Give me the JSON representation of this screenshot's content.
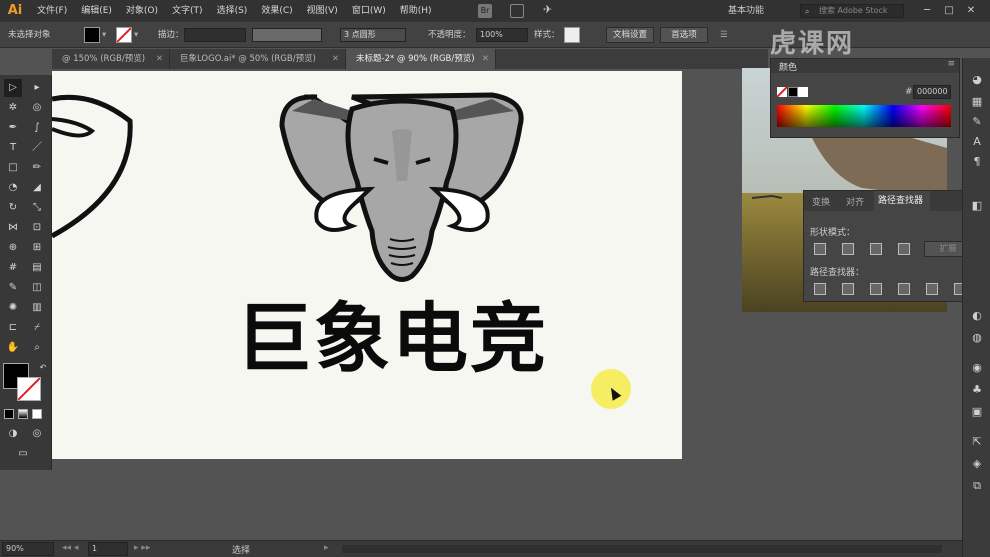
{
  "app": {
    "logo": "Ai"
  },
  "menu": [
    "文件(F)",
    "编辑(E)",
    "对象(O)",
    "文字(T)",
    "选择(S)",
    "效果(C)",
    "视图(V)",
    "窗口(W)",
    "帮助(H)"
  ],
  "workspace": "基本功能",
  "search_placeholder": "搜索 Adobe Stock",
  "control": {
    "selection": "未选择对象",
    "stroke_label": "描边：",
    "brush": "3 点圆形",
    "opacity_label": "不透明度：",
    "opacity_value": "100%",
    "style_label": "样式：",
    "doc_setup": "文档设置",
    "preferences": "首选项"
  },
  "tabs": [
    {
      "label": "@ 150% (RGB/预览)",
      "active": false
    },
    {
      "label": "巨象LOGO.ai* @ 50% (RGB/预览)",
      "active": false
    },
    {
      "label": "未标题-2* @ 90% (RGB/预览)",
      "active": true
    }
  ],
  "artwork": {
    "brand_text": "巨象电竞"
  },
  "color_panel": {
    "tab": "颜色",
    "hex": "000000",
    "hash": "#"
  },
  "pathfinder": {
    "tabs": [
      "变换",
      "对齐",
      "路径查找器"
    ],
    "shape_modes": "形状模式：",
    "expand": "扩展",
    "pathfinders": "路径查找器："
  },
  "watermark": "虎课网",
  "status": {
    "zoom": "90%",
    "page": "1",
    "tool": "选择"
  },
  "colors": {
    "accent": "#f29b2d",
    "panel": "#454545",
    "canvas": "#f7f7f2",
    "elephant_gray": "#a7a7a7"
  }
}
